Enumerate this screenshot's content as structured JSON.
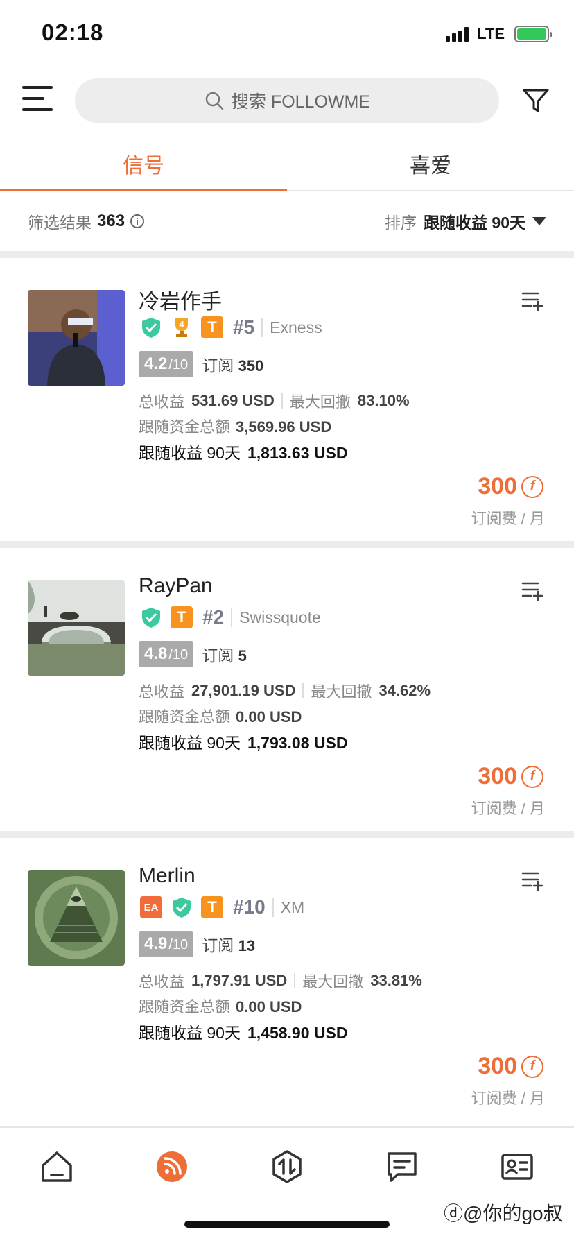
{
  "status_bar": {
    "time": "02:18",
    "network": "LTE"
  },
  "search": {
    "placeholder": "搜索 FOLLOWME"
  },
  "tabs": [
    {
      "label": "信号"
    },
    {
      "label": "喜爱"
    }
  ],
  "filter_bar": {
    "results_label": "筛选结果",
    "results_count": "363",
    "sort_label": "排序",
    "sort_value": "跟随收益 90天"
  },
  "cards": [
    {
      "name": "冷岩作手",
      "badges": [
        "verified-shield",
        "trophy-4",
        "T"
      ],
      "rank": "#5",
      "broker": "Exness",
      "score": "4.2",
      "score_max": "/10",
      "subs_label": "订阅",
      "subs_count": "350",
      "total_profit_label": "总收益",
      "total_profit": "531.69 USD",
      "max_drawdown_label": "最大回撤",
      "max_drawdown": "83.10%",
      "follow_funds_label": "跟随资金总额",
      "follow_funds": "3,569.96 USD",
      "follow_profit_label": "跟随收益 90天",
      "follow_profit": "1,813.63 USD",
      "price": "300",
      "fee_label": "订阅费 / 月"
    },
    {
      "name": "RayPan",
      "badges": [
        "verified-shield",
        "T"
      ],
      "rank": "#2",
      "broker": "Swissquote",
      "score": "4.8",
      "score_max": "/10",
      "subs_label": "订阅",
      "subs_count": "5",
      "total_profit_label": "总收益",
      "total_profit": "27,901.19 USD",
      "max_drawdown_label": "最大回撤",
      "max_drawdown": "34.62%",
      "follow_funds_label": "跟随资金总额",
      "follow_funds": "0.00 USD",
      "follow_profit_label": "跟随收益 90天",
      "follow_profit": "1,793.08 USD",
      "price": "300",
      "fee_label": "订阅费 / 月"
    },
    {
      "name": "Merlin",
      "badges": [
        "EA",
        "verified-shield",
        "T"
      ],
      "rank": "#10",
      "broker": "XM",
      "score": "4.9",
      "score_max": "/10",
      "subs_label": "订阅",
      "subs_count": "13",
      "total_profit_label": "总收益",
      "total_profit": "1,797.91 USD",
      "max_drawdown_label": "最大回撤",
      "max_drawdown": "33.81%",
      "follow_funds_label": "跟随资金总额",
      "follow_funds": "0.00 USD",
      "follow_profit_label": "跟随收益 90天",
      "follow_profit": "1,458.90 USD",
      "price": "300",
      "fee_label": "订阅费 / 月"
    }
  ],
  "badge_text": {
    "t": "T",
    "ea": "EA",
    "trophy": "4"
  },
  "bottom_nav": [
    "home-icon",
    "signal-feed-icon",
    "trade-icon",
    "message-icon",
    "profile-card-icon"
  ],
  "watermark": "你的go叔",
  "colors": {
    "accent": "#ee6e3a",
    "verified": "#3dc9a0",
    "t_badge": "#f7931e"
  }
}
